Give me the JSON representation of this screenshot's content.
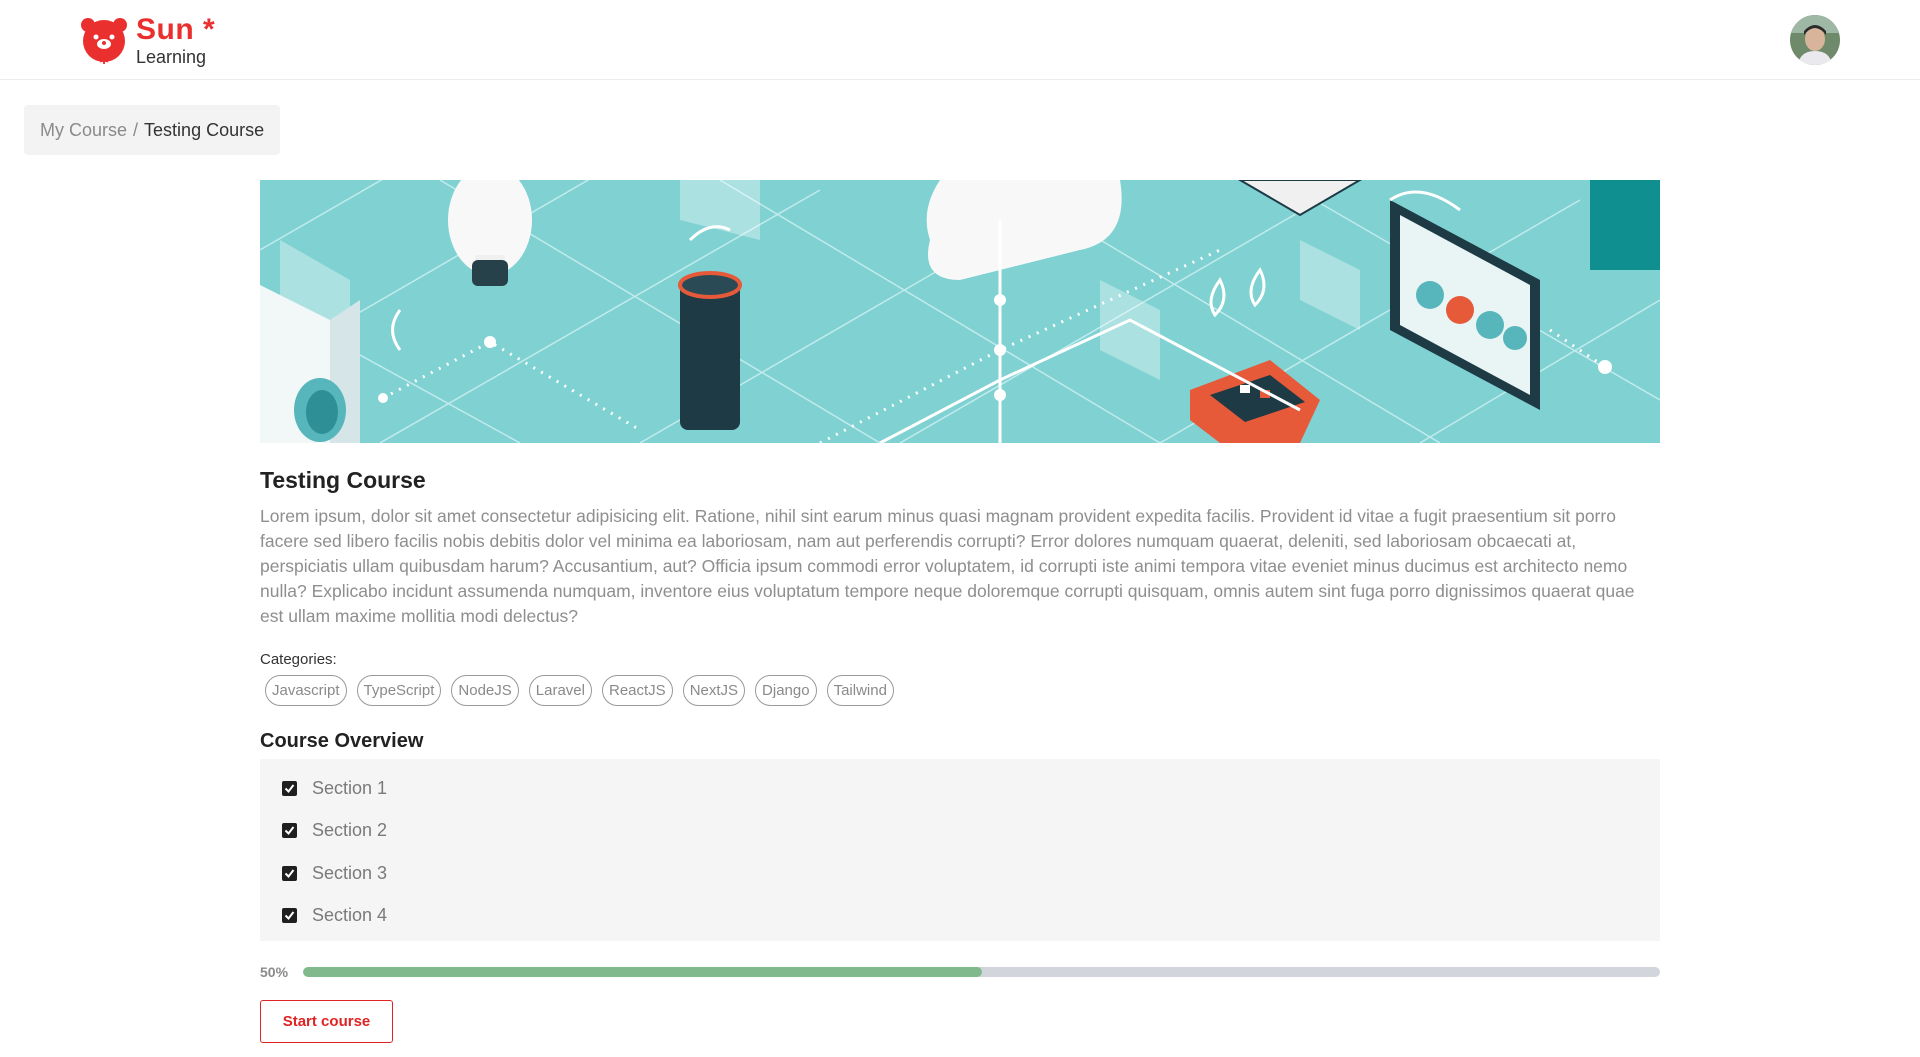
{
  "brand": {
    "name": "Sun",
    "star": "*",
    "subtitle": "Learning",
    "color": "#ea2f2f"
  },
  "header": {
    "avatar_icon": "user-avatar"
  },
  "breadcrumb": {
    "parent": "My Course",
    "separator": "/",
    "current": "Testing Course"
  },
  "course": {
    "title": "Testing Course",
    "description": "Lorem ipsum, dolor sit amet consectetur adipisicing elit. Ratione, nihil sint earum minus quasi magnam provident expedita facilis. Provident id vitae a fugit praesentium sit porro facere sed libero facilis nobis debitis dolor vel minima ea laboriosam, nam aut perferendis corrupti? Error dolores numquam quaerat, deleniti, sed laboriosam obcaecati at, perspiciatis ullam quibusdam harum? Accusantium, aut? Officia ipsum commodi error voluptatem, id corrupti iste animi tempora vitae eveniet minus ducimus est architecto nemo nulla? Explicabo incidunt assumenda numquam, inventore eius voluptatum tempore neque doloremque corrupti quisquam, omnis autem sint fuga porro dignissimos quaerat quae est ullam maxime mollitia modi delectus?",
    "banner_icon": "iot-illustration",
    "categories_label": "Categories:",
    "categories": [
      "Javascript",
      "TypeScript",
      "NodeJS",
      "Laravel",
      "ReactJS",
      "NextJS",
      "Django",
      "Tailwind"
    ],
    "overview_title": "Course Overview",
    "sections": [
      {
        "label": "Section 1",
        "checked": true
      },
      {
        "label": "Section 2",
        "checked": true
      },
      {
        "label": "Section 3",
        "checked": true
      },
      {
        "label": "Section 4",
        "checked": true
      }
    ],
    "progress": {
      "label": "50%",
      "value": 0.5,
      "fill_color": "#7fb98c"
    },
    "start_button": "Start course"
  }
}
